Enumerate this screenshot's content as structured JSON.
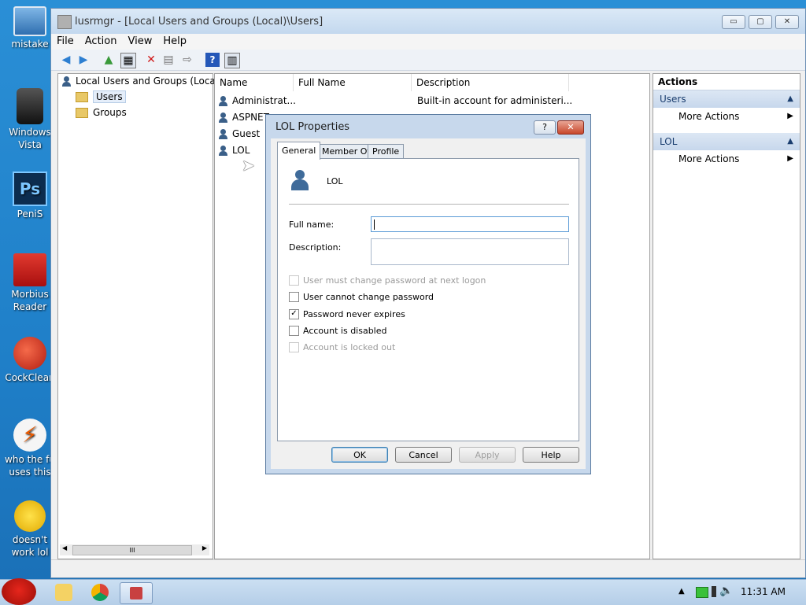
{
  "desktop": {
    "icons": [
      {
        "label": "mistake"
      },
      {
        "label": "Windows Vista"
      },
      {
        "label": "PeniS"
      },
      {
        "label": "Morbius Reader"
      },
      {
        "label": "CockClean"
      },
      {
        "label": "who the fu uses this"
      },
      {
        "label": "doesn't work lol"
      }
    ]
  },
  "window": {
    "title": "lusrmgr - [Local Users and Groups (Local)\\Users]",
    "controls": {
      "minimize": "▭",
      "maximize": "▢",
      "close": "✕"
    }
  },
  "menu": [
    "File",
    "Action",
    "View",
    "Help"
  ],
  "tree": {
    "root": "Local Users and Groups (Loca",
    "children": [
      "Users",
      "Groups"
    ],
    "hscroll": "III"
  },
  "list": {
    "columns": [
      "Name",
      "Full Name",
      "Description"
    ],
    "rows": [
      {
        "name": "Administrat...",
        "full_name": "",
        "description": "Built-in account for administeri..."
      },
      {
        "name": "ASPNET",
        "full_name": "",
        "description": ""
      },
      {
        "name": "Guest",
        "full_name": "",
        "description": ""
      },
      {
        "name": "LOL",
        "full_name": "",
        "description": ""
      }
    ]
  },
  "actions": {
    "header": "Actions",
    "sections": [
      {
        "title": "Users",
        "items": [
          "More Actions"
        ]
      },
      {
        "title": "LOL",
        "items": [
          "More Actions"
        ]
      }
    ]
  },
  "dialog": {
    "title": "LOL Properties",
    "help_btn": "?",
    "close_btn": "✕",
    "tabs": [
      "General",
      "Member Of",
      "Profile"
    ],
    "active_tab": "General",
    "user_name": "LOL",
    "full_name_label": "Full name:",
    "full_name_value": "",
    "description_label": "Description:",
    "description_value": "",
    "checkboxes": [
      {
        "label": "User must change password at next logon",
        "checked": false,
        "disabled": true
      },
      {
        "label": "User cannot change password",
        "checked": false,
        "disabled": false
      },
      {
        "label": "Password never expires",
        "checked": true,
        "disabled": false
      },
      {
        "label": "Account is disabled",
        "checked": false,
        "disabled": false
      },
      {
        "label": "Account is locked out",
        "checked": false,
        "disabled": true
      }
    ],
    "buttons": {
      "ok": "OK",
      "cancel": "Cancel",
      "apply": "Apply",
      "help": "Help"
    }
  },
  "taskbar": {
    "clock": "11:31 AM"
  }
}
